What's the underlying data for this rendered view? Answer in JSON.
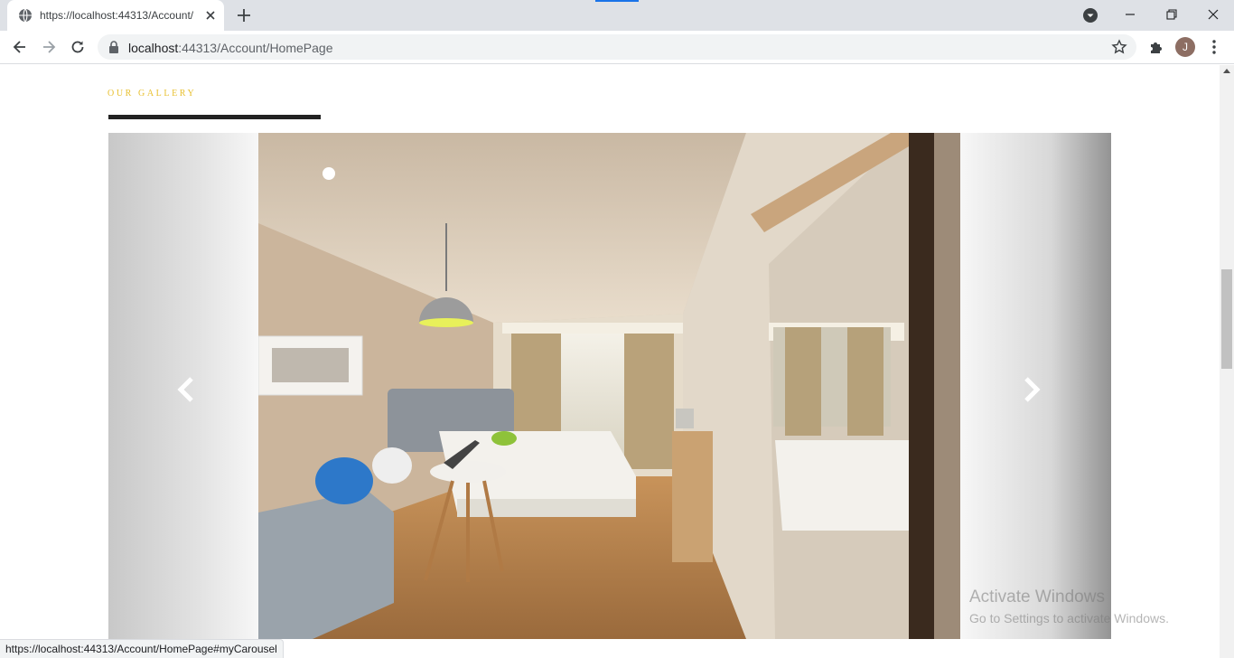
{
  "browser": {
    "tab_title": "https://localhost:44313/Account/",
    "url_host": "localhost",
    "url_rest": ":44313/Account/HomePage",
    "profile_initial": "J",
    "status_url": "https://localhost:44313/Account/HomePage#myCarousel"
  },
  "page": {
    "gallery_label": "OUR GALLERY",
    "accent_color": "#e8c030"
  },
  "carousel": {
    "slide_count": 3,
    "active_index": 0,
    "prev_icon": "chevron-left-icon",
    "next_icon": "chevron-right-icon"
  },
  "watermark": {
    "line1": "Activate Windows",
    "line2": "Go to Settings to activate Windows."
  }
}
